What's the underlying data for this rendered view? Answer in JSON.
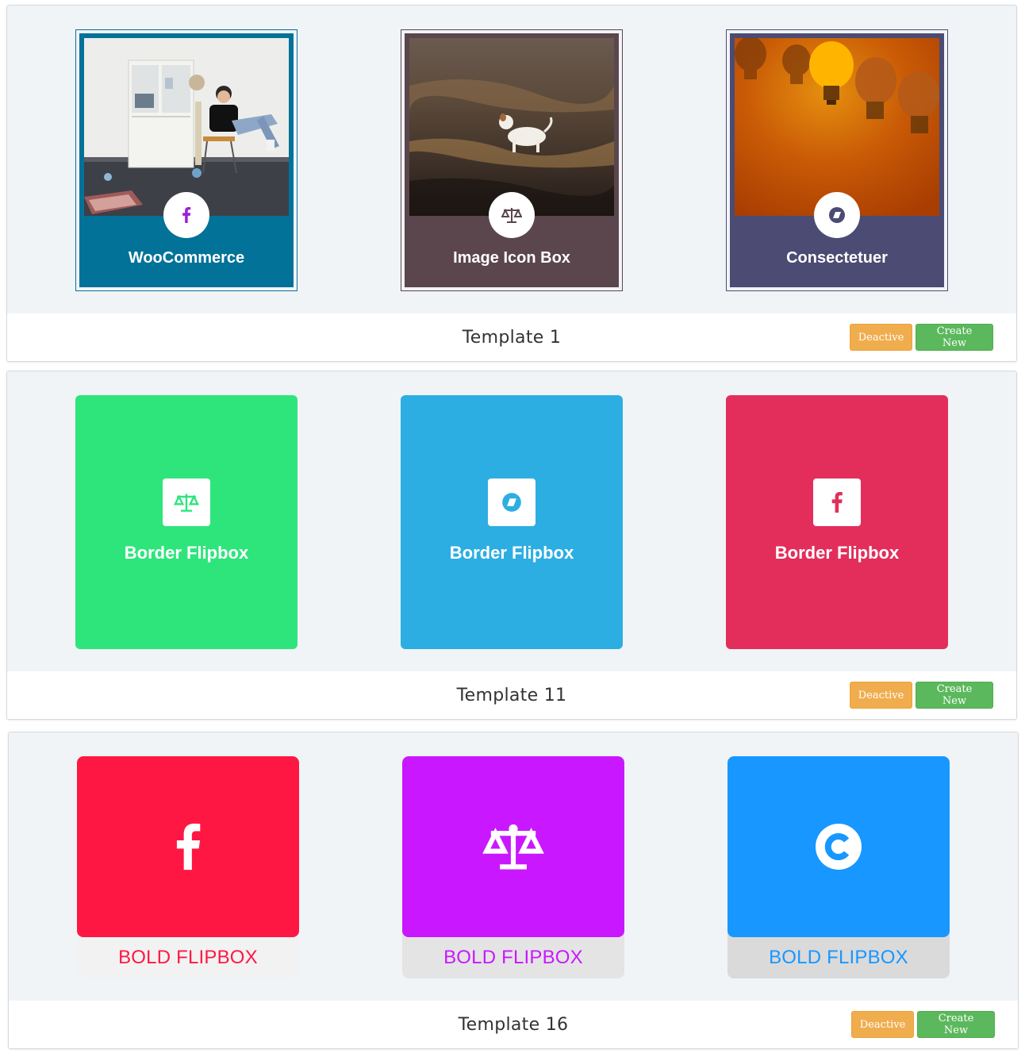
{
  "colors": {
    "deactive": "#f0ad4e",
    "create": "#5cb85c",
    "preview_bg": "#f1f4f7"
  },
  "templates": [
    {
      "name": "Template 1",
      "deactive_label": "Deactive",
      "create_label": "Create New",
      "cards": [
        {
          "label": "WooCommerce",
          "icon": "facebook-icon",
          "color": "#037299"
        },
        {
          "label": "Image Icon Box",
          "icon": "scale-icon",
          "color": "#5a464c"
        },
        {
          "label": "Consectetuer",
          "icon": "shape-icon",
          "color": "#4b4b73"
        }
      ]
    },
    {
      "name": "Template 11",
      "deactive_label": "Deactive",
      "create_label": "Create New",
      "cards": [
        {
          "label": "Border Flipbox",
          "icon": "scale-icon",
          "color": "#2ee57c"
        },
        {
          "label": "Border Flipbox",
          "icon": "shape-icon",
          "color": "#2daee3"
        },
        {
          "label": "Border Flipbox",
          "icon": "facebook-icon",
          "color": "#e32e5b"
        }
      ]
    },
    {
      "name": "Template 16",
      "deactive_label": "Deactive",
      "create_label": "Create New",
      "cards": [
        {
          "label": "BOLD FLIPBOX",
          "icon": "facebook-icon",
          "color": "#ff1744"
        },
        {
          "label": "BOLD FLIPBOX",
          "icon": "scale-icon",
          "color": "#c918ff"
        },
        {
          "label": "BOLD FLIPBOX",
          "icon": "copyright-icon",
          "color": "#1797ff"
        }
      ]
    }
  ]
}
